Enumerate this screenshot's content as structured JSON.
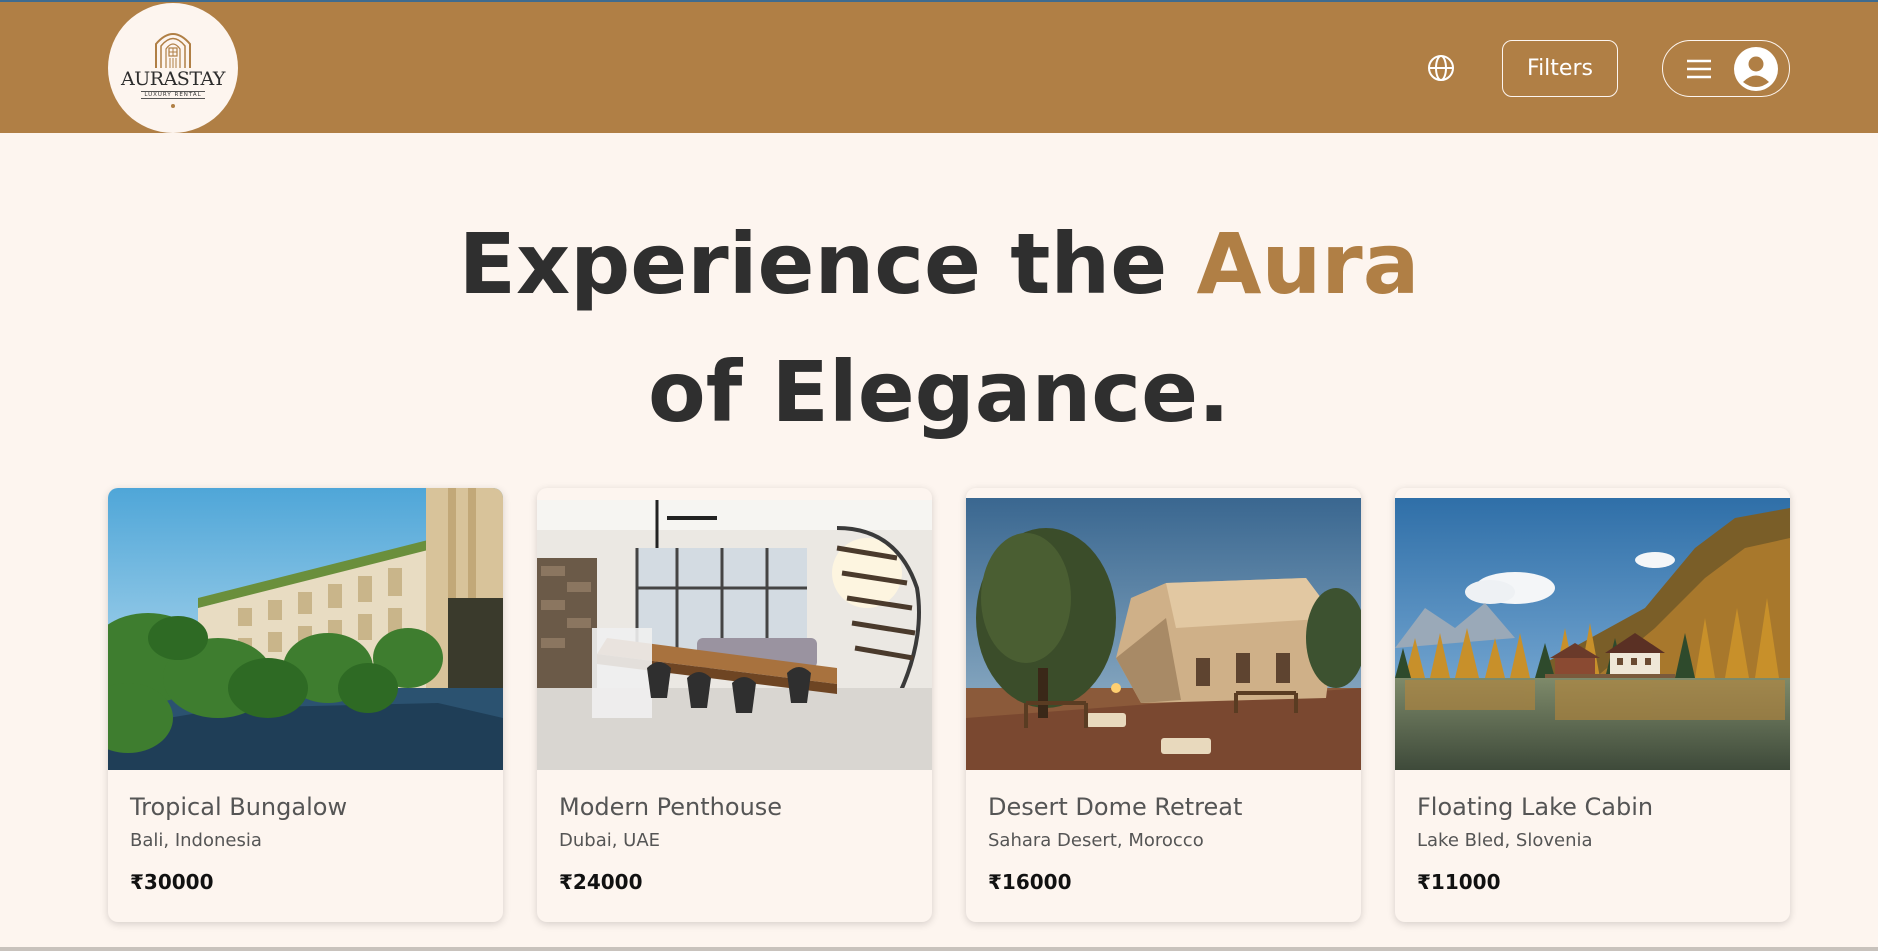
{
  "brand": {
    "name": "AURASTAY",
    "tagline": "LUXURY RENTAL",
    "color": "#b07f45"
  },
  "nav": {
    "globe_icon": "globe-icon",
    "filters_label": "Filters",
    "menu_icon": "hamburger-icon",
    "user_icon": "user-avatar-icon"
  },
  "hero": {
    "line1_start": "Experience the ",
    "line1_accent": "Aura",
    "line2": "of Elegance."
  },
  "listings": [
    {
      "title": "Tropical Bungalow",
      "location": "Bali, Indonesia",
      "price": "₹30000"
    },
    {
      "title": "Modern Penthouse",
      "location": "Dubai, UAE",
      "price": "₹24000"
    },
    {
      "title": "Desert Dome Retreat",
      "location": "Sahara Desert, Morocco",
      "price": "₹16000"
    },
    {
      "title": "Floating Lake Cabin",
      "location": "Lake Bled, Slovenia",
      "price": "₹11000"
    }
  ]
}
